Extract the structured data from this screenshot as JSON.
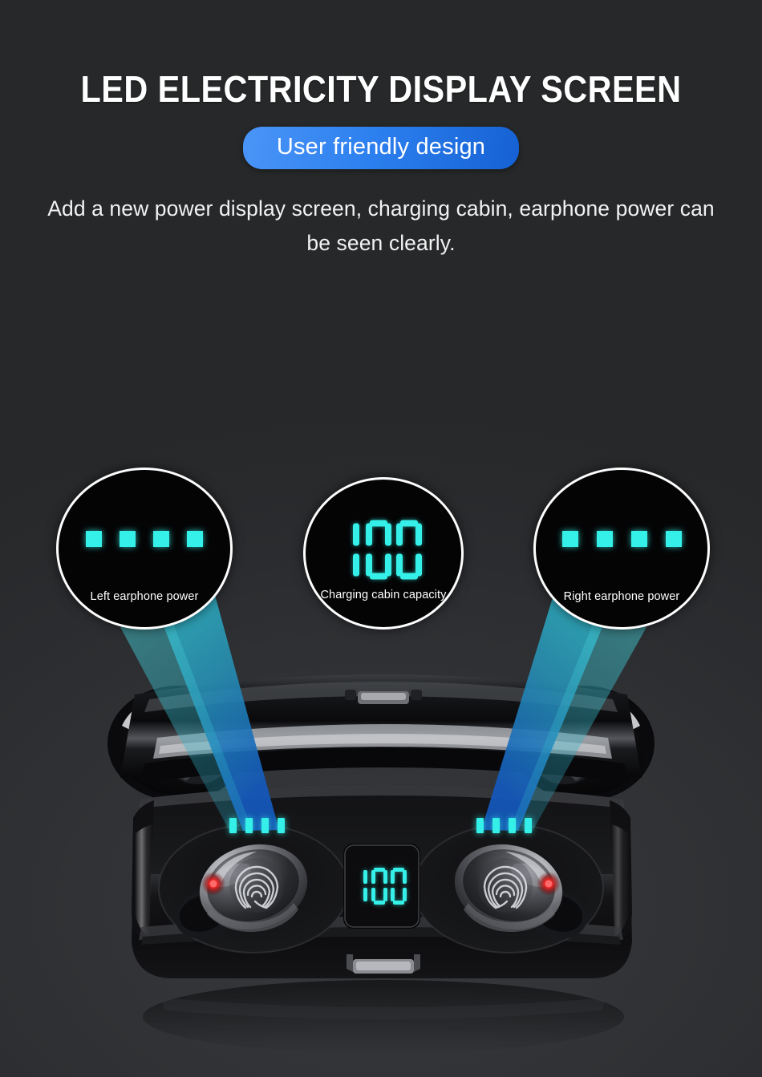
{
  "header": {
    "title": "LED ELECTRICITY DISPLAY SCREEN",
    "badge": "User friendly design",
    "description": "Add a new power display screen, charging cabin, earphone power can be seen clearly."
  },
  "callouts": [
    {
      "id": "left-earphone",
      "label": "Left earphone power",
      "indicator_type": "led-bars",
      "led_count": 4,
      "led_lit": 4
    },
    {
      "id": "charging-cabin",
      "label": "Charging cabin capacity",
      "indicator_type": "seven-segment",
      "value": "100"
    },
    {
      "id": "right-earphone",
      "label": "Right earphone power",
      "indicator_type": "led-bars",
      "led_count": 4,
      "led_lit": 4
    }
  ],
  "product": {
    "name": "wireless-earbuds-charging-case",
    "panel_value": "100",
    "left_led_bars": 4,
    "right_led_bars": 4,
    "earbud_left_indicator": "red-led",
    "earbud_right_indicator": "red-led",
    "earbud_surface": "fingerprint-touch-pad"
  },
  "colors": {
    "background": "#2b2d30",
    "accent_blue": "#2d80ef",
    "led_cyan": "#35f0e8",
    "beam_teal": "#2aa3b5",
    "beam_blue": "#1e6fd0",
    "earbud_led_red": "#ff2020",
    "text_primary": "#ffffff"
  }
}
